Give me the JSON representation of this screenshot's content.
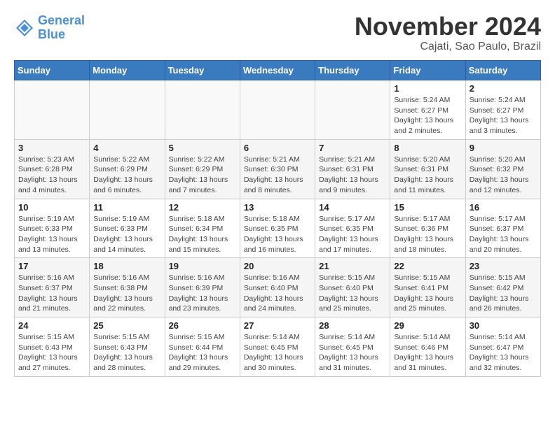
{
  "header": {
    "logo_line1": "General",
    "logo_line2": "Blue",
    "month_title": "November 2024",
    "location": "Cajati, Sao Paulo, Brazil"
  },
  "days_of_week": [
    "Sunday",
    "Monday",
    "Tuesday",
    "Wednesday",
    "Thursday",
    "Friday",
    "Saturday"
  ],
  "weeks": [
    {
      "days": [
        {
          "date": "",
          "info": ""
        },
        {
          "date": "",
          "info": ""
        },
        {
          "date": "",
          "info": ""
        },
        {
          "date": "",
          "info": ""
        },
        {
          "date": "",
          "info": ""
        },
        {
          "date": "1",
          "info": "Sunrise: 5:24 AM\nSunset: 6:27 PM\nDaylight: 13 hours and 2 minutes."
        },
        {
          "date": "2",
          "info": "Sunrise: 5:24 AM\nSunset: 6:27 PM\nDaylight: 13 hours and 3 minutes."
        }
      ]
    },
    {
      "days": [
        {
          "date": "3",
          "info": "Sunrise: 5:23 AM\nSunset: 6:28 PM\nDaylight: 13 hours and 4 minutes."
        },
        {
          "date": "4",
          "info": "Sunrise: 5:22 AM\nSunset: 6:29 PM\nDaylight: 13 hours and 6 minutes."
        },
        {
          "date": "5",
          "info": "Sunrise: 5:22 AM\nSunset: 6:29 PM\nDaylight: 13 hours and 7 minutes."
        },
        {
          "date": "6",
          "info": "Sunrise: 5:21 AM\nSunset: 6:30 PM\nDaylight: 13 hours and 8 minutes."
        },
        {
          "date": "7",
          "info": "Sunrise: 5:21 AM\nSunset: 6:31 PM\nDaylight: 13 hours and 9 minutes."
        },
        {
          "date": "8",
          "info": "Sunrise: 5:20 AM\nSunset: 6:31 PM\nDaylight: 13 hours and 11 minutes."
        },
        {
          "date": "9",
          "info": "Sunrise: 5:20 AM\nSunset: 6:32 PM\nDaylight: 13 hours and 12 minutes."
        }
      ]
    },
    {
      "days": [
        {
          "date": "10",
          "info": "Sunrise: 5:19 AM\nSunset: 6:33 PM\nDaylight: 13 hours and 13 minutes."
        },
        {
          "date": "11",
          "info": "Sunrise: 5:19 AM\nSunset: 6:33 PM\nDaylight: 13 hours and 14 minutes."
        },
        {
          "date": "12",
          "info": "Sunrise: 5:18 AM\nSunset: 6:34 PM\nDaylight: 13 hours and 15 minutes."
        },
        {
          "date": "13",
          "info": "Sunrise: 5:18 AM\nSunset: 6:35 PM\nDaylight: 13 hours and 16 minutes."
        },
        {
          "date": "14",
          "info": "Sunrise: 5:17 AM\nSunset: 6:35 PM\nDaylight: 13 hours and 17 minutes."
        },
        {
          "date": "15",
          "info": "Sunrise: 5:17 AM\nSunset: 6:36 PM\nDaylight: 13 hours and 18 minutes."
        },
        {
          "date": "16",
          "info": "Sunrise: 5:17 AM\nSunset: 6:37 PM\nDaylight: 13 hours and 20 minutes."
        }
      ]
    },
    {
      "days": [
        {
          "date": "17",
          "info": "Sunrise: 5:16 AM\nSunset: 6:37 PM\nDaylight: 13 hours and 21 minutes."
        },
        {
          "date": "18",
          "info": "Sunrise: 5:16 AM\nSunset: 6:38 PM\nDaylight: 13 hours and 22 minutes."
        },
        {
          "date": "19",
          "info": "Sunrise: 5:16 AM\nSunset: 6:39 PM\nDaylight: 13 hours and 23 minutes."
        },
        {
          "date": "20",
          "info": "Sunrise: 5:16 AM\nSunset: 6:40 PM\nDaylight: 13 hours and 24 minutes."
        },
        {
          "date": "21",
          "info": "Sunrise: 5:15 AM\nSunset: 6:40 PM\nDaylight: 13 hours and 25 minutes."
        },
        {
          "date": "22",
          "info": "Sunrise: 5:15 AM\nSunset: 6:41 PM\nDaylight: 13 hours and 25 minutes."
        },
        {
          "date": "23",
          "info": "Sunrise: 5:15 AM\nSunset: 6:42 PM\nDaylight: 13 hours and 26 minutes."
        }
      ]
    },
    {
      "days": [
        {
          "date": "24",
          "info": "Sunrise: 5:15 AM\nSunset: 6:43 PM\nDaylight: 13 hours and 27 minutes."
        },
        {
          "date": "25",
          "info": "Sunrise: 5:15 AM\nSunset: 6:43 PM\nDaylight: 13 hours and 28 minutes."
        },
        {
          "date": "26",
          "info": "Sunrise: 5:15 AM\nSunset: 6:44 PM\nDaylight: 13 hours and 29 minutes."
        },
        {
          "date": "27",
          "info": "Sunrise: 5:14 AM\nSunset: 6:45 PM\nDaylight: 13 hours and 30 minutes."
        },
        {
          "date": "28",
          "info": "Sunrise: 5:14 AM\nSunset: 6:45 PM\nDaylight: 13 hours and 31 minutes."
        },
        {
          "date": "29",
          "info": "Sunrise: 5:14 AM\nSunset: 6:46 PM\nDaylight: 13 hours and 31 minutes."
        },
        {
          "date": "30",
          "info": "Sunrise: 5:14 AM\nSunset: 6:47 PM\nDaylight: 13 hours and 32 minutes."
        }
      ]
    }
  ]
}
